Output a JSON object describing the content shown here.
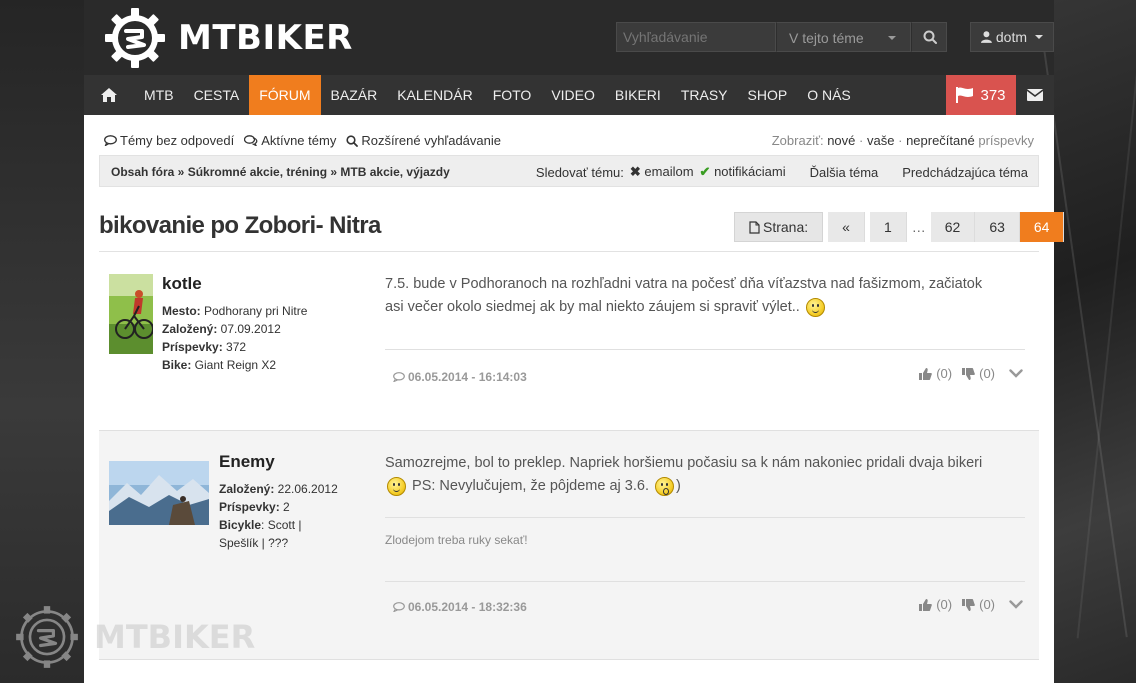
{
  "brand": {
    "name": "MTBIKER"
  },
  "search": {
    "placeholder": "Vyhľadávanie",
    "scope": "V tejto téme"
  },
  "user": {
    "name": "dotm"
  },
  "nav": {
    "items": [
      "MTB",
      "CESTA",
      "FÓRUM",
      "BAZÁR",
      "KALENDÁR",
      "FOTO",
      "VIDEO",
      "BIKERI",
      "TRASY",
      "SHOP",
      "O NÁS"
    ],
    "active": "FÓRUM",
    "flag_count": "373"
  },
  "toplinks": {
    "unanswered": "Témy bez odpovedí",
    "active": "Aktívne témy",
    "advanced": "Rozšírené vyhľadávanie"
  },
  "show": {
    "label": "Zobraziť:",
    "new": "nové",
    "dot": "·",
    "yours": "vaše",
    "unread": "neprečítané",
    "posts": "príspevky"
  },
  "breadcrumb": "Obsah fóra » Súkromné akcie, tréning » MTB akcie, výjazdy",
  "follow": {
    "label": "Sledovať tému:",
    "email": "emailom",
    "notify": "notifikáciami",
    "next": "Ďalšia téma",
    "prev": "Predchádzajúca téma"
  },
  "thread_title": "bikovanie po Zobori- Nitra",
  "pagination": {
    "label": "Strana:",
    "prev": "«",
    "pages": [
      "1",
      "…",
      "62",
      "63",
      "64"
    ],
    "current": "64"
  },
  "posts": [
    {
      "author": "kotle",
      "fields": [
        {
          "k": "Mesto:",
          "v": " Podhorany pri Nitre"
        },
        {
          "k": "Založený:",
          "v": " 07.09.2012"
        },
        {
          "k": "Príspevky:",
          "v": " 372"
        },
        {
          "k": "Bike:",
          "v": " Giant Reign X2"
        }
      ],
      "text_1": "7.5. bude v Podhoranoch na rozhľadni vatra na počesť dňa víťazstva nad fašizmom, začiatok",
      "text_2": "asi večer okolo siedmej ak by mal niekto záujem si spraviť výlet..",
      "date": "06.05.2014 - 16:14:03",
      "likes": "(0)",
      "dislikes": "(0)"
    },
    {
      "author": "Enemy",
      "fields": [
        {
          "k": "Založený:",
          "v": " 22.06.2012"
        },
        {
          "k": "Príspevky:",
          "v": " 2"
        },
        {
          "k": "Bicykle",
          "v": ": Scott |"
        },
        {
          "k": "",
          "v": "Spešlík | ???"
        }
      ],
      "text_1": "Samozrejme, bol to preklep. Napriek horšiemu počasiu sa k nám nakoniec pridali dvaja bikeri",
      "text_2a": "PS: Nevylučujem, že pôjdeme aj 3.6.",
      "text_2b": ")",
      "signature": "Zlodejom treba ruky sekať!",
      "date": "06.05.2014 - 18:32:36",
      "likes": "(0)",
      "dislikes": "(0)"
    }
  ],
  "watermark": {
    "text": "MTBIKER"
  }
}
